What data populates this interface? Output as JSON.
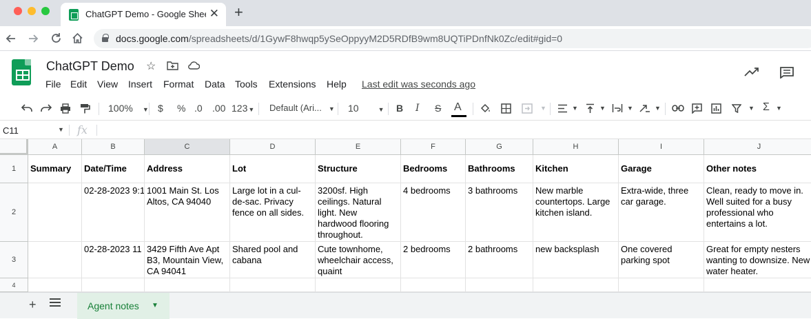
{
  "browser": {
    "tab_title": "ChatGPT Demo - Google Sheets",
    "close_glyph": "✕",
    "new_tab_glyph": "+",
    "url_host": "docs.google.com",
    "url_path": "/spreadsheets/d/1GywF8hwqp5ySeOppyyM2D5RDfB9wm8UQTiPDnfNk0Zc/edit#gid=0",
    "nav_icons": [
      "back-arrow-icon",
      "forward-arrow-icon",
      "reload-icon",
      "home-icon"
    ]
  },
  "doc": {
    "title": "ChatGPT Demo",
    "menu": [
      "File",
      "Edit",
      "View",
      "Insert",
      "Format",
      "Data",
      "Tools",
      "Extensions",
      "Help"
    ],
    "last_edit": "Last edit was seconds ago"
  },
  "toolbar": {
    "zoom": "100%",
    "currency": "$",
    "percent": "%",
    "decrease_decimals": ".0",
    "increase_decimals": ".00",
    "number_format": "123",
    "font_family": "Default (Ari...",
    "font_size": "10",
    "bold": "B",
    "italic": "I",
    "strikethrough": "S",
    "text_color": "A"
  },
  "formula_bar": {
    "cell_ref": "C11",
    "fx": "fx",
    "value": ""
  },
  "grid": {
    "columns": [
      "A",
      "B",
      "C",
      "D",
      "E",
      "F",
      "G",
      "H",
      "I",
      "J"
    ],
    "active_column": "C",
    "row_numbers": [
      "1",
      "2",
      "3",
      "4"
    ],
    "rows": [
      [
        "Summary",
        "Date/Time",
        "Address",
        "Lot",
        "Structure",
        "Bedrooms",
        "Bathrooms",
        "Kitchen",
        "Garage",
        "Other notes"
      ],
      [
        "",
        "02-28-2023 9:1",
        "1001 Main St. Los Altos, CA 94040",
        "Large lot in a cul-de-sac. Privacy fence on all sides.",
        "3200sf. High ceilings. Natural light. New hardwood flooring throughout.",
        "4 bedrooms",
        "3 bathrooms",
        "New marble countertops. Large kitchen island.",
        "Extra-wide, three car garage.",
        "Clean, ready to move in. Well suited for a busy professional who entertains a lot."
      ],
      [
        "",
        "02-28-2023 11",
        "3429 Fifth Ave Apt B3, Mountain View, CA 94041",
        "Shared pool and cabana",
        "Cute townhome, wheelchair access, quaint",
        "2 bedrooms",
        "2 bathrooms",
        "new backsplash",
        "One covered parking spot",
        "Great for empty nesters wanting to downsize. New water heater."
      ],
      [
        "",
        "",
        "",
        "",
        "",
        "",
        "",
        "",
        "",
        ""
      ]
    ]
  },
  "sheets": {
    "add_glyph": "+",
    "active_tab": "Agent notes"
  }
}
